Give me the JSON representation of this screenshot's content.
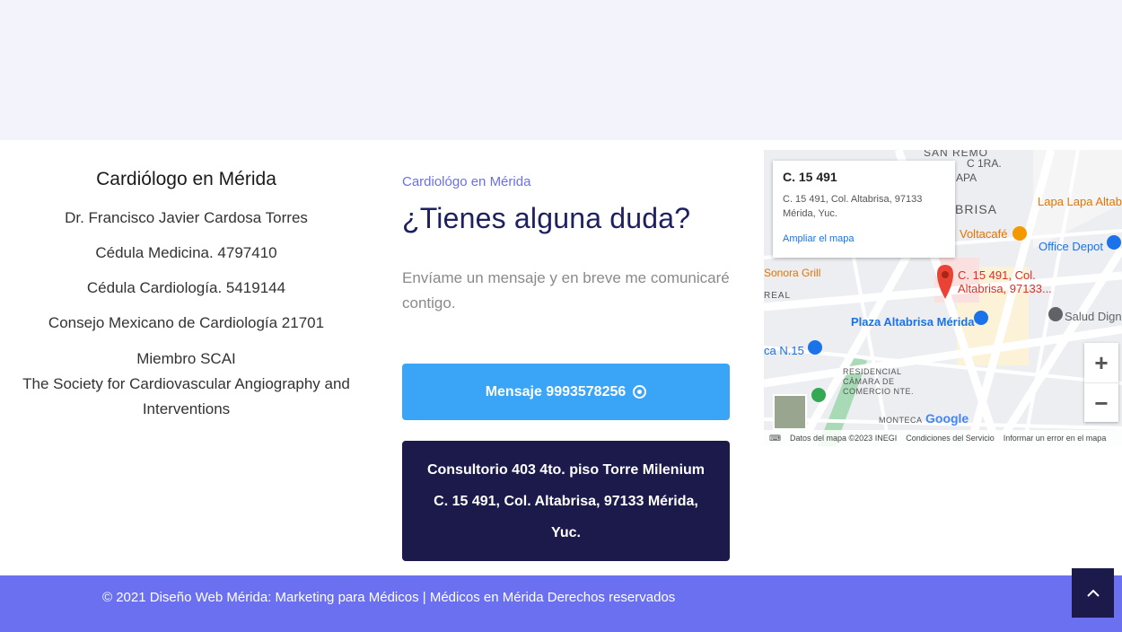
{
  "profile": {
    "title": "Cardiólogo en Mérida",
    "lines": [
      "Dr. Francisco Javier Cardosa Torres",
      "Cédula Medicina. 4797410",
      "Cédula Cardiología. 5419144",
      "Consejo Mexicano de Cardiología 21701"
    ],
    "scai_line1": "Miembro SCAI",
    "scai_line2": "The Society for Cardiovascular Angiography and Interventions"
  },
  "contact": {
    "eyebrow": "Cardiológo en Mérida",
    "heading": "¿Tienes alguna duda?",
    "description": "Envíame un mensaje y en breve me comunicaré contigo.",
    "message_button": "Mensaje 9993578256",
    "message_icon": "whatsapp-icon",
    "address": "Consultorio 403 4to. piso Torre Milenium C. 15 491, Col. Altabrisa, 97133 Mérida, Yuc."
  },
  "map": {
    "card_title": "C. 15 491",
    "card_address": "C. 15 491, Col. Altabrisa, 97133 Mérida, Yuc.",
    "card_link": "Ampliar el mapa",
    "pin_label": "C. 15 491, Col. Altabrisa, 97133...",
    "labels": {
      "san_remo": "SAN REMO",
      "c1ra": "C 1RA.",
      "apa": "APA",
      "brisa": "BRISA",
      "lapa": "Lapa Lapa Altab",
      "voltacafe": "Voltacafé",
      "office_depot": "Office Depot",
      "sonora": "Sonora Grill",
      "plaza": "Plaza Altabrisa Mérida",
      "salud": "Salud Digna",
      "ca_n15": "ca N.15",
      "residencial": "RESIDENCIAL\nCÁMARA DE\nCOMERCIO NTE.",
      "monteca": "MONTECA",
      "real": "REAL"
    },
    "zoom_in": "+",
    "zoom_out": "−",
    "google": "Google",
    "attribution_data": "Datos del mapa ©2023 INEGI",
    "attribution_terms": "Condiciones del Servicio",
    "attribution_report": "Informar un error en el mapa",
    "colors": {
      "water": "#e8eaed",
      "road": "#ffffff",
      "pin": "#ea4335",
      "park": "#a8dab5",
      "link": "#1a73e8"
    }
  },
  "footer": {
    "text": "© 2021 Diseño Web Mérida: Marketing para Médicos | Médicos en Mérida Derechos reservados",
    "to_top_icon": "chevron-up-icon"
  }
}
